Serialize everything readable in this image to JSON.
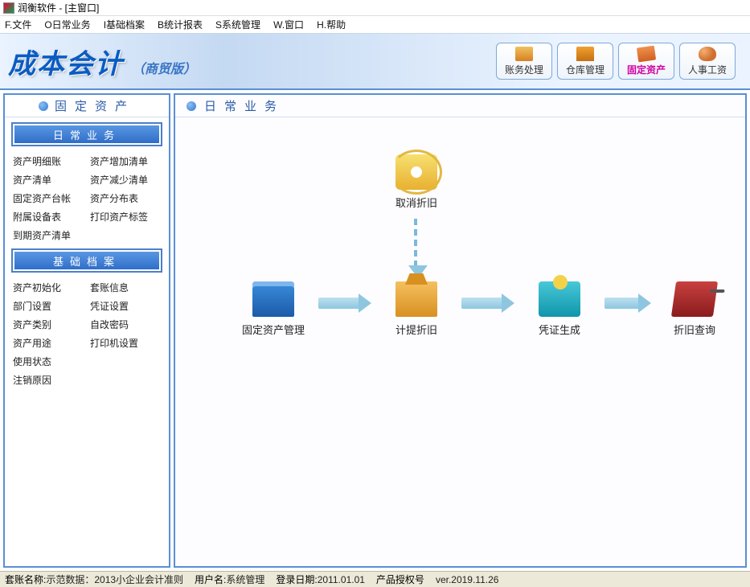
{
  "window": {
    "title": "润衡软件 - [主窗口]"
  },
  "menus": [
    "F.文件",
    "O日常业务",
    "I基础档案",
    "B统计报表",
    "S系统管理",
    "W.窗口",
    "H.帮助"
  ],
  "header": {
    "title": "成本会计",
    "subtitle": "（商贸版）",
    "buttons": [
      {
        "label": "账务处理",
        "icon": "book",
        "active": false
      },
      {
        "label": "仓库管理",
        "icon": "box",
        "active": false
      },
      {
        "label": "固定资产",
        "icon": "tool",
        "active": true
      },
      {
        "label": "人事工资",
        "icon": "people",
        "active": false
      }
    ]
  },
  "sidebar": {
    "title": "固定资产",
    "sections": [
      {
        "title": "日常业务",
        "links": [
          "资产明细账",
          "资产增加清单",
          "资产清单",
          "资产减少清单",
          "固定资产台帐",
          "资产分布表",
          "附属设备表",
          "打印资产标签",
          "到期资产清单",
          ""
        ]
      },
      {
        "title": "基础档案",
        "links": [
          "资产初始化",
          "套账信息",
          "部门设置",
          "凭证设置",
          "资产类别",
          "自改密码",
          "资产用途",
          "打印机设置",
          "使用状态",
          "",
          "注销原因",
          ""
        ]
      }
    ]
  },
  "content": {
    "title": "日常业务",
    "nodes": {
      "cancel": "取消折旧",
      "manage": "固定资产管理",
      "extract": "计提折旧",
      "voucher": "凭证生成",
      "query": "折旧查询"
    }
  },
  "status": {
    "account_label": "套账名称:",
    "account_value": "示范数据：2013小企业会计准则",
    "user_label": "用户名:",
    "user_value": "系统管理",
    "login_label": "登录日期:",
    "login_value": "2011.01.01",
    "lic_label": "产品授权号",
    "ver_value": "ver.2019.11.26"
  }
}
